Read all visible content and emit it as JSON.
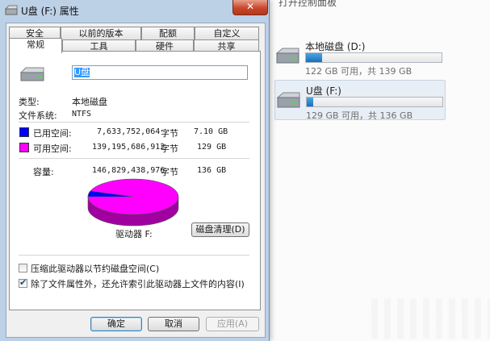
{
  "background": {
    "title": "打开控制面板",
    "drives": [
      {
        "name": "本地磁盘 (D:)",
        "info": "122 GB 可用，共 139 GB",
        "used_fraction": 0.12
      },
      {
        "name": "U盘 (F:)",
        "info": "129 GB 可用，共 136 GB",
        "used_fraction": 0.05
      }
    ]
  },
  "window": {
    "title": "U盘 (F:) 属性",
    "close": "✕"
  },
  "tabs": {
    "row1": [
      "安全",
      "以前的版本",
      "配额",
      "自定义"
    ],
    "row2": [
      "常规",
      "工具",
      "硬件",
      "共享"
    ]
  },
  "general": {
    "name_value": "U盘",
    "type_label": "类型:",
    "type_value": "本地磁盘",
    "fs_label": "文件系统:",
    "fs_value": "NTFS",
    "used_label": "已用空间:",
    "used_bytes": "7,633,752,064",
    "used_unit": "字节",
    "used_size": "7.10 GB",
    "free_label": "可用空间:",
    "free_bytes": "139,195,686,912",
    "free_unit": "字节",
    "free_size": "129 GB",
    "cap_label": "容量:",
    "cap_bytes": "146,829,438,976",
    "cap_unit": "字节",
    "cap_size": "136 GB",
    "drive_label": "驱动器 F:",
    "cleanup_button": "磁盘清理(D)",
    "compress_label": "压缩此驱动器以节约磁盘空间(C)",
    "compress_checked": false,
    "index_label": "除了文件属性外，还允许索引此驱动器上文件的内容(I)",
    "index_checked": true,
    "used_color": "#0000ff",
    "free_color": "#ff00ff"
  },
  "buttons": {
    "ok": "确定",
    "cancel": "取消",
    "apply": "应用(A)"
  }
}
